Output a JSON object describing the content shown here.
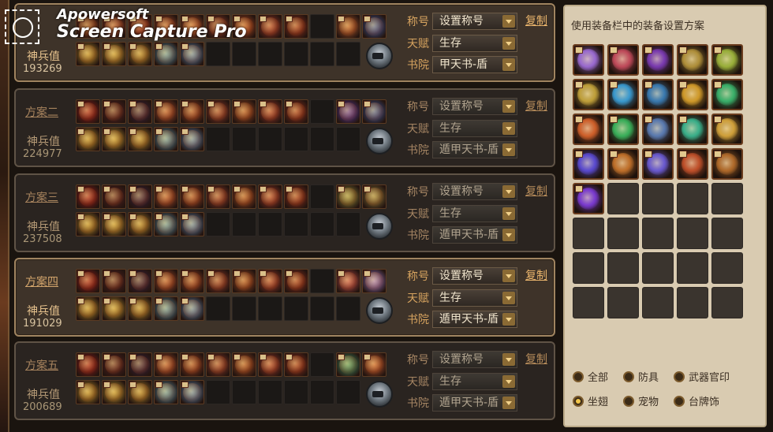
{
  "watermark": {
    "line1": "Apowersoft",
    "line2": "Screen Capture Pro"
  },
  "labels": {
    "power": "神兵值",
    "copy": "复制",
    "title_field": "称号",
    "talent_field": "天赋",
    "academy_field": "书院"
  },
  "plans": [
    {
      "name": "",
      "power": "193269",
      "title": "设置称号",
      "talent": "生存",
      "academy": "甲天书-盾",
      "active": true,
      "top_colors": [
        "#8b3a1a",
        "#a8452a",
        "#a03020",
        "#b04a28",
        "#c0552a",
        "#9a3a28",
        "#b84a20",
        "#a83828",
        "#9b2f1b",
        "",
        "#b85a2a",
        "#3b5ca8"
      ],
      "bottom_colors": [
        "#b8902a",
        "#c09a30",
        "#b0882a",
        "#5a9ab0",
        "#5a8ab8",
        "",
        "",
        "",
        "",
        "",
        ""
      ]
    },
    {
      "name": "方案二",
      "power": "224977",
      "title": "设置称号",
      "talent": "生存",
      "academy": "遁甲天书-盾",
      "active": false,
      "top_colors": [
        "#a01818",
        "#5a2020",
        "#3a2040",
        "#b04a28",
        "#a04020",
        "#9a3a28",
        "#a84a20",
        "#a83828",
        "#9b2f1b",
        "",
        "#5a3aa8",
        "#3b5ca8"
      ],
      "bottom_colors": [
        "#b8902a",
        "#c09a30",
        "#b0882a",
        "#5a9ab0",
        "#5a8ab8",
        "",
        "",
        "",
        "",
        "",
        ""
      ]
    },
    {
      "name": "方案三",
      "power": "237508",
      "title": "设置称号",
      "talent": "生存",
      "academy": "遁甲天书-盾",
      "active": false,
      "top_colors": [
        "#a01818",
        "#5a2020",
        "#3a2040",
        "#b04a28",
        "#a04020",
        "#9a3a28",
        "#a84a20",
        "#a83828",
        "#9b2f1b",
        "",
        "#8a8a3a",
        "#8a7a3a"
      ],
      "bottom_colors": [
        "#b8902a",
        "#c09a30",
        "#b0882a",
        "#5a9ab0",
        "#5a8ab8",
        "",
        "",
        "",
        "",
        "",
        ""
      ]
    },
    {
      "name": "方案四",
      "power": "191029",
      "title": "设置称号",
      "talent": "生存",
      "academy": "遁甲天书-盾",
      "active": true,
      "top_colors": [
        "#a01818",
        "#5a2020",
        "#3a2040",
        "#b04a28",
        "#a04020",
        "#9a3a28",
        "#a84a20",
        "#a83828",
        "#9b2f1b",
        "",
        "#c04a4a",
        "#9a7ad0"
      ],
      "bottom_colors": [
        "#b8902a",
        "#c09a30",
        "#b0882a",
        "#5a9ab0",
        "#5a8ab8",
        "",
        "",
        "",
        "",
        "",
        ""
      ]
    },
    {
      "name": "方案五",
      "power": "200689",
      "title": "设置称号",
      "talent": "生存",
      "academy": "遁甲天书-盾",
      "active": false,
      "top_colors": [
        "#a01818",
        "#5a2020",
        "#3a2040",
        "#b04a28",
        "#a04020",
        "#9a3a28",
        "#a84a20",
        "#a83828",
        "#9b2f1b",
        "",
        "#3a9a6a",
        "#c0552a"
      ],
      "bottom_colors": [
        "#b8902a",
        "#c09a30",
        "#b0882a",
        "#5a9ab0",
        "#5a8ab8",
        "",
        "",
        "",
        "",
        "",
        ""
      ]
    }
  ],
  "side": {
    "title": "使用装备栏中的装备设置方案",
    "grid_colors": [
      "#9a6ad0",
      "#c04a5a",
      "#7a3ab0",
      "#b0903a",
      "#9ab03a",
      "#c0a03a",
      "#3a9ad0",
      "#3a7ab0",
      "#d09a2a",
      "#3ab06a",
      "#d0602a",
      "#3ab05a",
      "#5a7ab0",
      "#3ab08a",
      "#d0a03a",
      "#5a4ad0",
      "#c0702a",
      "#6a5ad0",
      "#c0502a",
      "#b06a2a",
      "#7a3ad0",
      "",
      "",
      "",
      "",
      "",
      "",
      "",
      "",
      "",
      "",
      "",
      "",
      "",
      "",
      "",
      "",
      "",
      "",
      ""
    ],
    "filters": [
      {
        "label": "全部",
        "selected": false
      },
      {
        "label": "防具",
        "selected": false
      },
      {
        "label": "武器官印",
        "selected": false
      },
      {
        "label": "坐翅",
        "selected": true
      },
      {
        "label": "宠物",
        "selected": false
      },
      {
        "label": "台牌饰",
        "selected": false
      }
    ]
  }
}
